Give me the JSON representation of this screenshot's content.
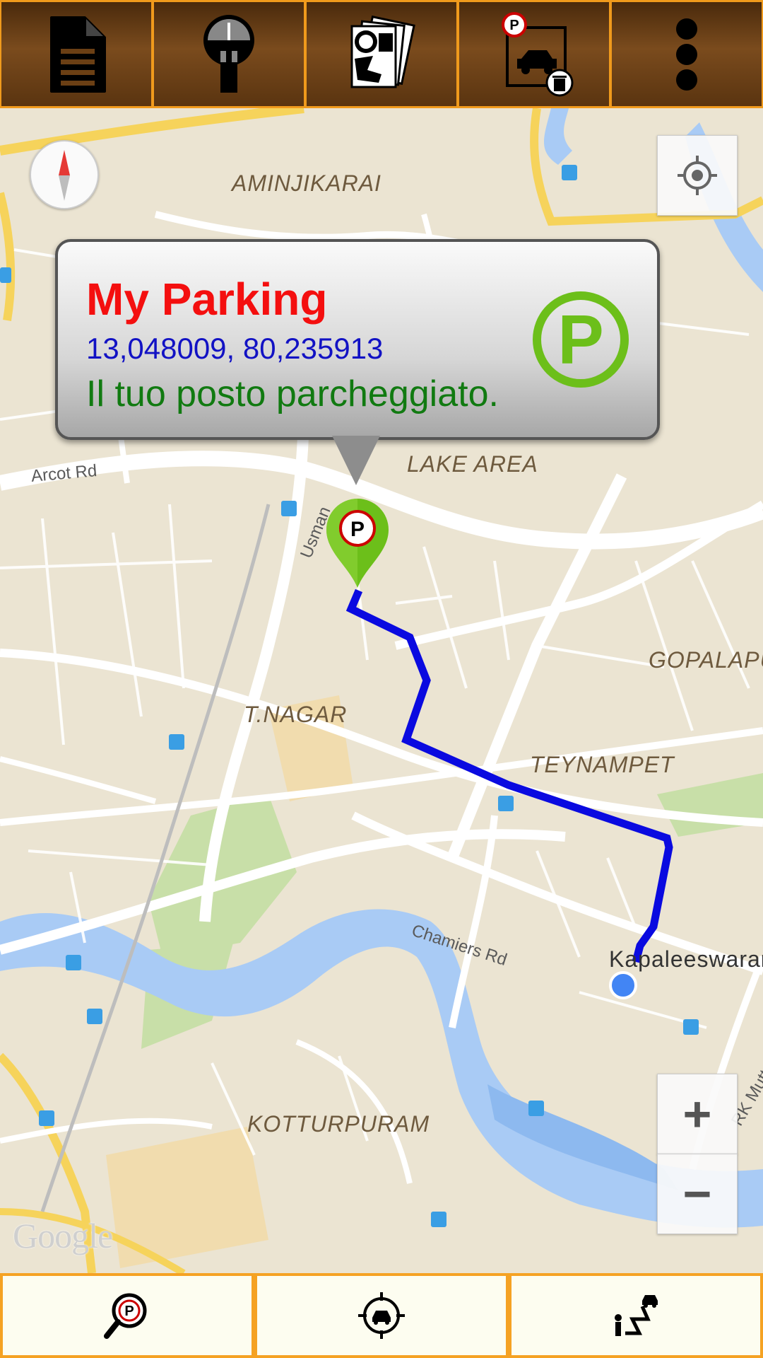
{
  "toolbar": {
    "buttons": [
      {
        "icon": "document-icon"
      },
      {
        "icon": "parking-meter-icon"
      },
      {
        "icon": "maps-icon"
      },
      {
        "icon": "delete-parking-icon"
      },
      {
        "icon": "overflow-menu-icon"
      }
    ]
  },
  "map": {
    "labels": {
      "aminjikarai": "AMINJIKARAI",
      "lake_area": "LAKE AREA",
      "gopalapuram": "GOPALAPU",
      "t_nagar": "T.NAGAR",
      "teynampet": "TEYNAMPET",
      "kotturpuram": "KOTTURPURAM",
      "kapaleeswarar": "Kapaleeswarar"
    },
    "roads": {
      "arcot_rd": "Arcot Rd",
      "usman": "Usman",
      "chamiers_rd": "Chamiers Rd",
      "rk_mutt": "RK Mutt"
    },
    "attribution": "Google",
    "zoom_in_label": "+",
    "zoom_out_label": "−",
    "route_color": "#0a0ae0"
  },
  "popup": {
    "title": "My Parking",
    "coordinates": "13,048009, 80,235913",
    "description": "Il tuo posto parcheggiato."
  },
  "bottom_toolbar": {
    "buttons": [
      {
        "icon": "find-parking-icon"
      },
      {
        "icon": "locate-car-icon"
      },
      {
        "icon": "route-to-car-icon"
      }
    ]
  },
  "colors": {
    "toolbar_border": "#f09a1c",
    "popup_title": "#f40f0f",
    "popup_coords": "#1212c4",
    "popup_desc": "#117a11",
    "parking_green": "#6cbf1a"
  }
}
